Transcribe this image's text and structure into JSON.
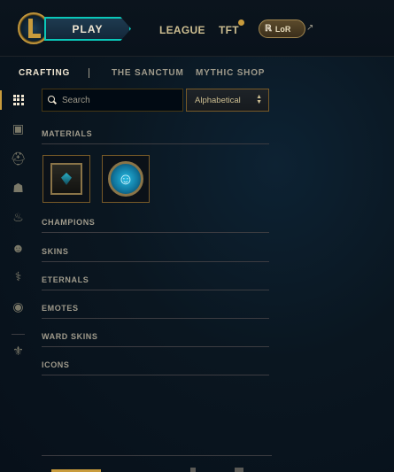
{
  "topnav": {
    "play_label": "PLAY",
    "league_label": "LEAGUE",
    "tft_label": "TFT",
    "lor_label": "LoR",
    "lor_glyph": "ℝ",
    "external_glyph": "↗"
  },
  "subnav": {
    "tabs": [
      {
        "label": "CRAFTING",
        "active": true
      },
      {
        "label": "THE SANCTUM",
        "active": false
      },
      {
        "label": "MYTHIC SHOP",
        "active": false
      }
    ]
  },
  "sidebar": {
    "icons": [
      "grid-icon",
      "chest-icon",
      "champion-helmet-icon",
      "mask-icon",
      "flame-icon",
      "emote-face-icon",
      "ward-icon",
      "profile-icon",
      "loot-special-icon"
    ],
    "glyphs": {
      "chest": "▣",
      "helmet": "⛑",
      "mask": "☗",
      "flame": "♨",
      "face": "☻",
      "ward": "⚕",
      "profile": "◉",
      "special": "⚜"
    }
  },
  "search": {
    "placeholder": "Search",
    "value": ""
  },
  "sort": {
    "selected": "Alphabetical",
    "arrows_up": "▲",
    "arrows_down": "▼"
  },
  "categories": [
    {
      "label": "MATERIALS"
    },
    {
      "label": "CHAMPIONS"
    },
    {
      "label": "SKINS"
    },
    {
      "label": "ETERNALS"
    },
    {
      "label": "EMOTES"
    },
    {
      "label": "WARD SKINS"
    },
    {
      "label": "ICONS"
    }
  ],
  "materials": {
    "emote_face": "☺"
  },
  "colors": {
    "gold": "#c89b3c",
    "teal": "#0ac8b9",
    "text": "#cdbe91",
    "muted": "#a09b8c"
  }
}
